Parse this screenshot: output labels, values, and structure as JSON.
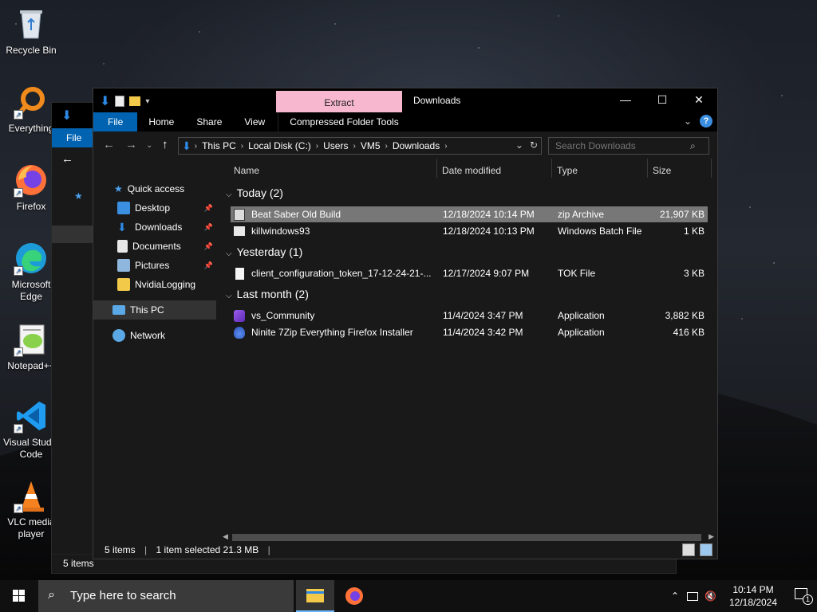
{
  "desktop": {
    "icons": [
      {
        "label": "Recycle Bin"
      },
      {
        "label": "Everything"
      },
      {
        "label": "Firefox"
      },
      {
        "label": "Microsoft Edge"
      },
      {
        "label": "Notepad++"
      },
      {
        "label": "Visual Studio Code"
      },
      {
        "label": "VLC media player"
      }
    ]
  },
  "bg_window": {
    "ribbon_file": "File",
    "status": "5 items"
  },
  "explorer": {
    "context_tab": "Extract",
    "title": "Downloads",
    "ribbon": {
      "file": "File",
      "home": "Home",
      "share": "Share",
      "view": "View",
      "compressed": "Compressed Folder Tools"
    },
    "path": [
      "This PC",
      "Local Disk (C:)",
      "Users",
      "VM5",
      "Downloads"
    ],
    "search_placeholder": "Search Downloads",
    "nav": {
      "quick_access": "Quick access",
      "desktop": "Desktop",
      "downloads": "Downloads",
      "documents": "Documents",
      "pictures": "Pictures",
      "nvidia": "NvidiaLogging",
      "this_pc": "This PC",
      "network": "Network"
    },
    "columns": {
      "name": "Name",
      "date": "Date modified",
      "type": "Type",
      "size": "Size"
    },
    "groups": [
      {
        "label": "Today (2)",
        "files": [
          {
            "name": "Beat Saber Old Build",
            "date": "12/18/2024 10:14 PM",
            "type": "zip Archive",
            "size": "21,907 KB"
          },
          {
            "name": "killwindows93",
            "date": "12/18/2024 10:13 PM",
            "type": "Windows Batch File",
            "size": "1 KB"
          }
        ]
      },
      {
        "label": "Yesterday (1)",
        "files": [
          {
            "name": "client_configuration_token_17-12-24-21-...",
            "date": "12/17/2024 9:07 PM",
            "type": "TOK File",
            "size": "3 KB"
          }
        ]
      },
      {
        "label": "Last month (2)",
        "files": [
          {
            "name": "vs_Community",
            "date": "11/4/2024 3:47 PM",
            "type": "Application",
            "size": "3,882 KB"
          },
          {
            "name": "Ninite 7Zip Everything Firefox Installer",
            "date": "11/4/2024 3:42 PM",
            "type": "Application",
            "size": "416 KB"
          }
        ]
      }
    ],
    "status": {
      "items": "5 items",
      "selected": "1 item selected  21.3 MB"
    }
  },
  "taskbar": {
    "search_placeholder": "Type here to search",
    "time": "10:14 PM",
    "date": "12/18/2024",
    "notification_count": "1"
  }
}
